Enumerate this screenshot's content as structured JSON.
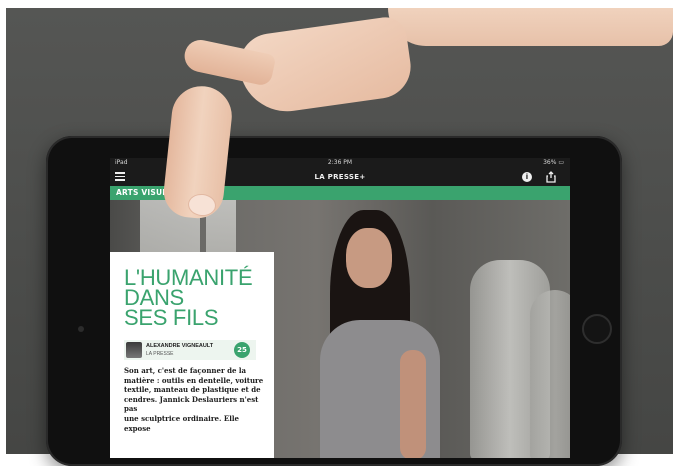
{
  "status_bar": {
    "device": "iPad",
    "time": "2:36 PM",
    "battery": "36%"
  },
  "nav_bar": {
    "title": "LA PRESSE+",
    "menu_icon": "hamburger-menu-icon",
    "info_icon": "info-icon",
    "share_icon": "share-icon"
  },
  "section": {
    "label": "ARTS VISUELS"
  },
  "article": {
    "headline_lines": [
      "L'HUMANITÉ",
      "DANS",
      "SES FILS"
    ],
    "author_name": "ALEXANDRE VIGNEAULT",
    "author_org": "LA PRESSE",
    "comment_count": "25",
    "body_lines": [
      "Son art, c'est de façonner de la",
      "matière : outils en dentelle, voiture",
      "textile, manteau de plastique et de",
      "cendres. Jannick Deslauriers n'est pas",
      "une sculptrice ordinaire. Elle expose"
    ]
  },
  "colors": {
    "accent": "#3aa36e",
    "nav_background": "#1b1b1b",
    "card_background": "#ffffff"
  }
}
